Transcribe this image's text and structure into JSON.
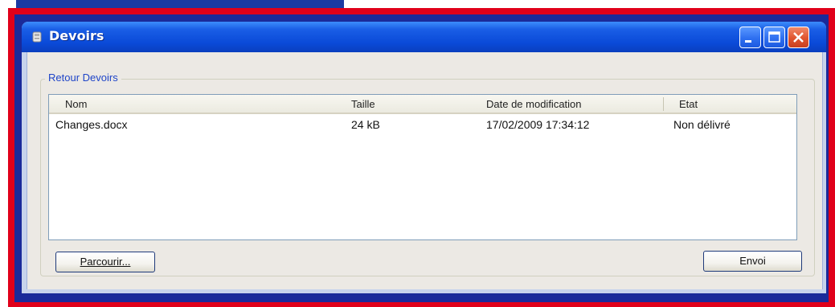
{
  "window": {
    "title": "Devoirs",
    "app_icon": "devoirs-app-icon",
    "controls": [
      "minimize-icon",
      "maximize-icon",
      "close-icon"
    ]
  },
  "group": {
    "legend": "Retour Devoirs"
  },
  "list": {
    "columns": [
      "Nom",
      "Taille",
      "Date de modification",
      "Etat"
    ],
    "rows": [
      {
        "nom": "Changes.docx",
        "taille": "24 kB",
        "date": "17/02/2009 17:34:12",
        "etat": "Non délivré"
      }
    ]
  },
  "buttons": {
    "browse": "Parcourir...",
    "send": "Envoi"
  },
  "colors": {
    "highlight_frame": "#e0001a",
    "titlebar": "#0a4ad8",
    "legend_text": "#1f45c8",
    "close_button": "#e0542e"
  }
}
